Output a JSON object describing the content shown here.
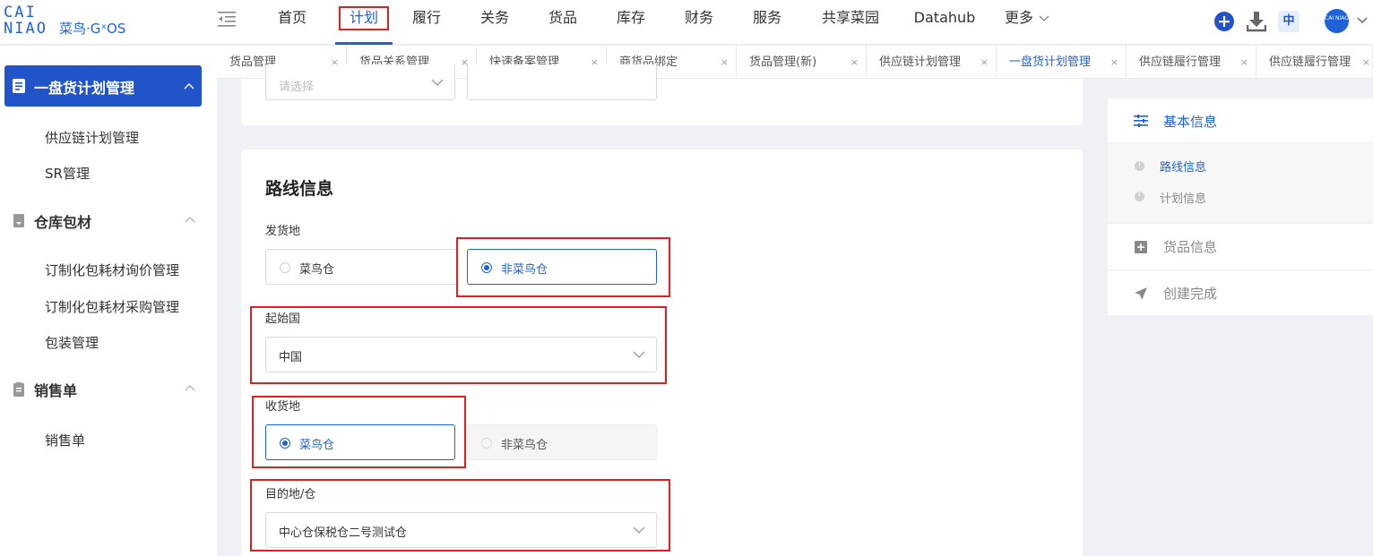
{
  "logo": {
    "line1": "CAI",
    "line2": "NIAO",
    "suffix": "菜鸟·GˣOS"
  },
  "nav": [
    {
      "label": "首页"
    },
    {
      "label": "计划"
    },
    {
      "label": "履行"
    },
    {
      "label": "关务"
    },
    {
      "label": "货品"
    },
    {
      "label": "库存"
    },
    {
      "label": "财务"
    },
    {
      "label": "服务"
    },
    {
      "label": "共享菜园"
    },
    {
      "label": "Datahub"
    },
    {
      "label": "更多"
    }
  ],
  "top_right": {
    "lang": "中",
    "avatar_text": "CAI NIAO"
  },
  "tabs": [
    {
      "label": "货品管理"
    },
    {
      "label": "货品关系管理"
    },
    {
      "label": "快速备案管理"
    },
    {
      "label": "商货品绑定"
    },
    {
      "label": "货品管理(新)"
    },
    {
      "label": "供应链计划管理"
    },
    {
      "label": "一盘货计划管理"
    },
    {
      "label": "供应链履行管理"
    },
    {
      "label": "供应链履行管理"
    }
  ],
  "tab_close": "×",
  "sidebar": {
    "active_group": "一盘货计划管理",
    "group1_items": [
      "供应链计划管理",
      "SR管理"
    ],
    "group2": "仓库包材",
    "group2_items": [
      "订制化包耗材询价管理",
      "订制化包耗材采购管理",
      "包装管理"
    ],
    "group3": "销售单",
    "group3_items": [
      "销售单"
    ]
  },
  "form": {
    "top_select_placeholder": "请选择",
    "section_title": "路线信息",
    "ship_from_label": "发货地",
    "ship_from_options": [
      "菜鸟仓",
      "非菜鸟仓"
    ],
    "origin_country_label": "起始国",
    "origin_country_value": "中国",
    "receive_label": "收货地",
    "receive_options": [
      "菜鸟仓",
      "非菜鸟仓"
    ],
    "destination_label": "目的地/仓",
    "destination_value": "中心仓保税仓二号测试仓"
  },
  "right_panel": {
    "basic_info": "基本信息",
    "sub_items": [
      "路线信息",
      "计划信息"
    ],
    "goods_info": "货品信息",
    "create_done": "创建完成"
  },
  "colors": {
    "brand_blue": "#1f62d6",
    "sidebar_active": "#2254c9",
    "annotation_red": "#e02020"
  }
}
